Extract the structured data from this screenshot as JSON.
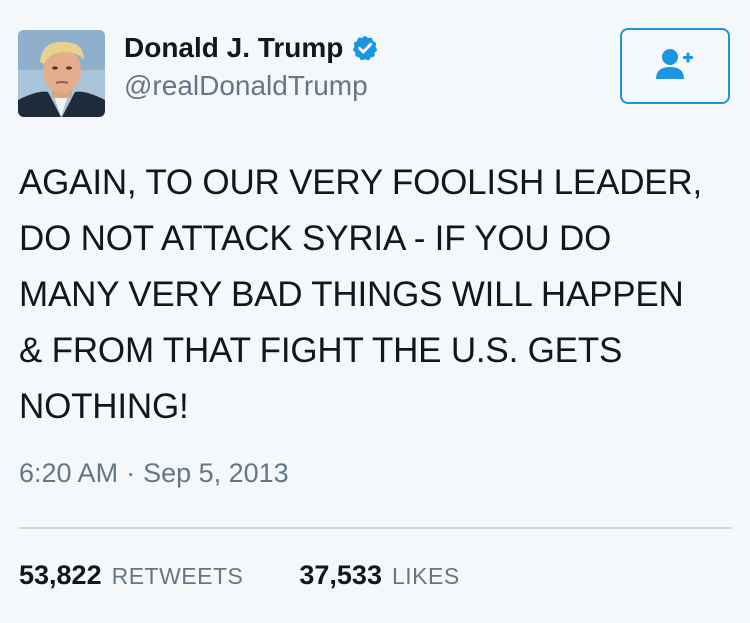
{
  "user": {
    "display_name": "Donald J. Trump",
    "handle": "@realDonaldTrump",
    "verified": true
  },
  "tweet": {
    "text": "AGAIN, TO OUR VERY FOOLISH LEADER,\nDO NOT ATTACK SYRIA - IF YOU DO\nMANY VERY BAD THINGS WILL HAPPEN\n& FROM THAT FIGHT THE U.S. GETS\nNOTHING!",
    "time": "6:20 AM",
    "separator": "·",
    "date": "Sep 5, 2013"
  },
  "stats": {
    "retweets_count": "53,822",
    "retweets_label": "RETWEETS",
    "likes_count": "37,533",
    "likes_label": "LIKES"
  },
  "icons": {
    "verified": "verified-badge-icon",
    "follow": "add-user-icon"
  },
  "colors": {
    "accent": "#1b95e0",
    "text": "#14171a",
    "secondary": "#657786",
    "background": "#f5f8fa",
    "divider": "#ccd6dd"
  }
}
